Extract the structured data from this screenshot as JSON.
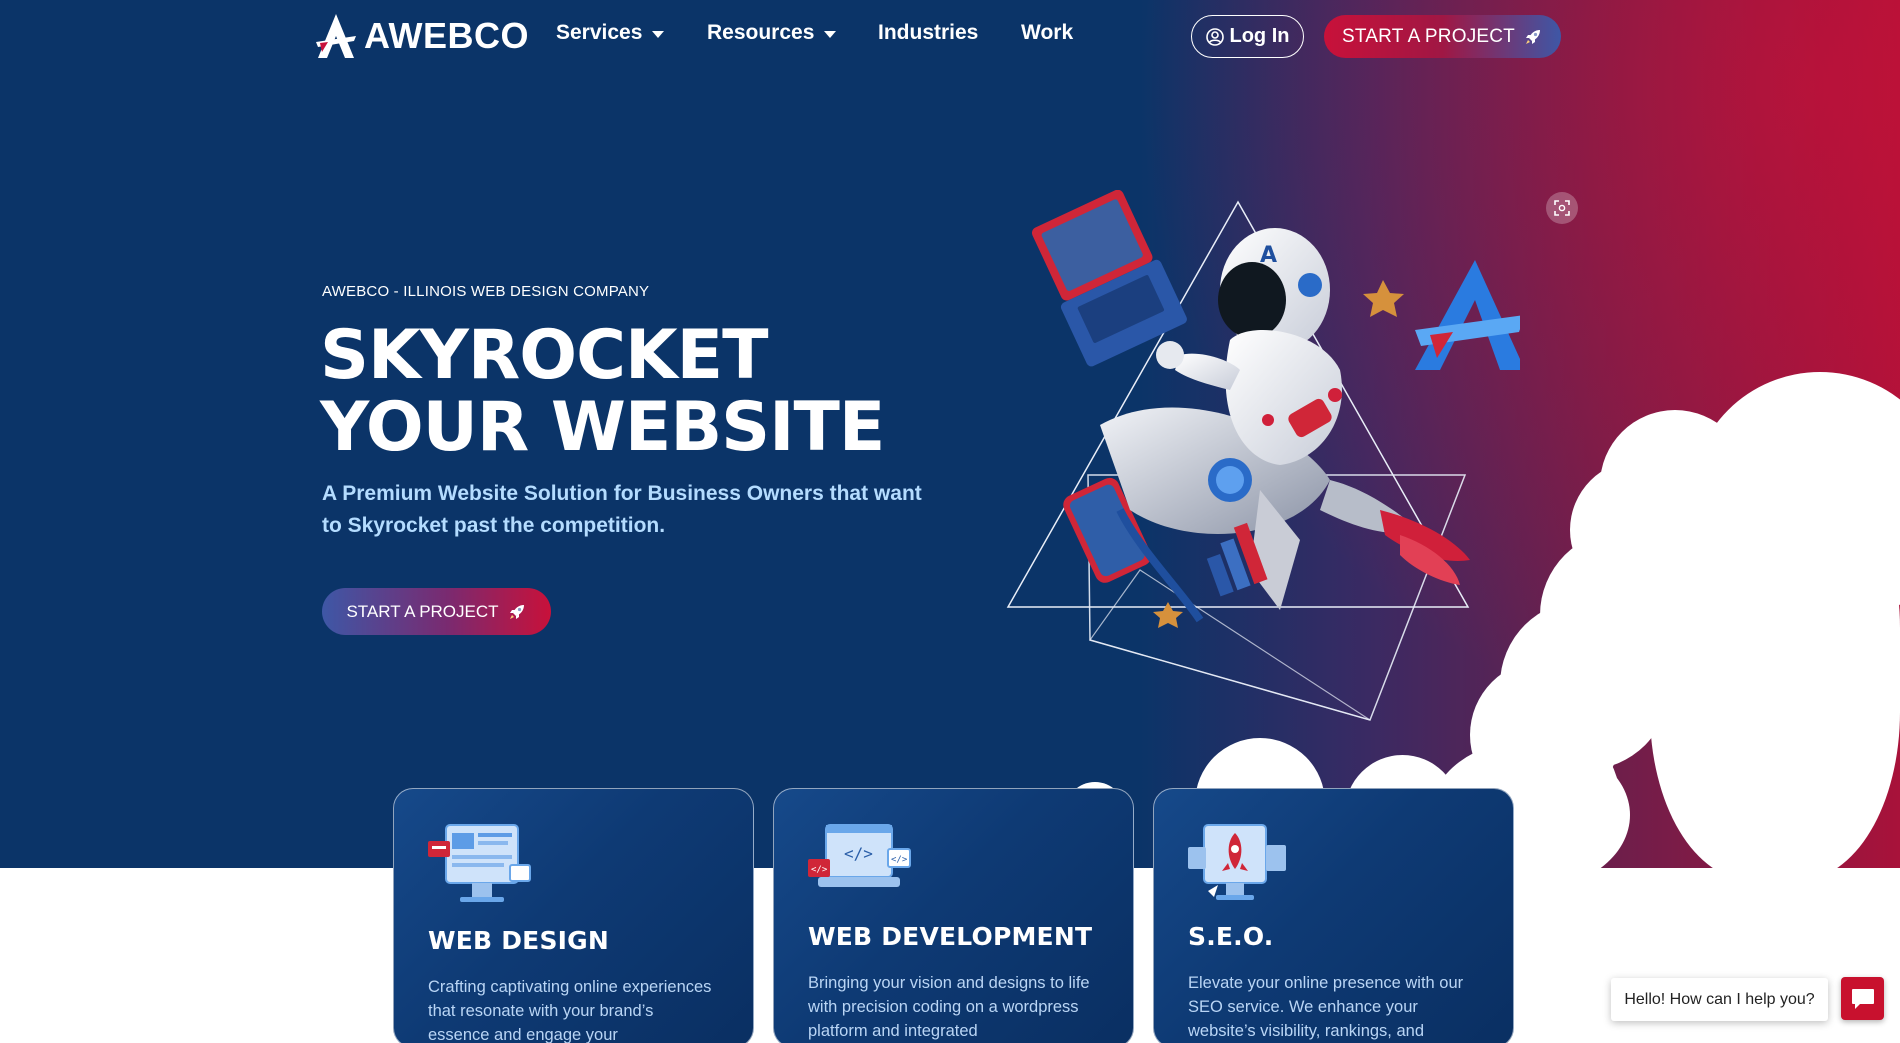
{
  "brand": {
    "name": "AWEBCO"
  },
  "nav": {
    "items": [
      {
        "label": "Services",
        "dropdown": true
      },
      {
        "label": "Resources",
        "dropdown": true
      },
      {
        "label": "Industries",
        "dropdown": false
      },
      {
        "label": "Work",
        "dropdown": false
      }
    ],
    "login_label": "Log In",
    "cta_label": "START A PROJECT"
  },
  "hero": {
    "eyebrow": "AWEBCO - ILLINOIS WEB DESIGN COMPANY",
    "headline_line1": "SKYROCKET",
    "headline_line2": "YOUR WEBSITE",
    "subline": "A Premium Website Solution for Business Owners that want to Skyrocket past the competition.",
    "cta_label": "START A PROJECT"
  },
  "cards": [
    {
      "title": "WEB DESIGN",
      "text": "Crafting captivating online experiences that resonate with your brand’s essence and engage your"
    },
    {
      "title": "WEB DEVELOPMENT",
      "text": "Bringing your vision and designs to life with precision coding on a wordpress platform and integrated"
    },
    {
      "title": "S.E.O.",
      "text": "Elevate your online presence with our SEO service. We enhance your website’s visibility, rankings, and"
    }
  ],
  "chat": {
    "greeting": "Hello! How can I help you?"
  },
  "colors": {
    "navy": "#0b3468",
    "crimson": "#c8113a",
    "light_blue_text": "#b4dcff",
    "card_text": "#b9d5f5"
  },
  "icons": [
    "awebco-logo-icon",
    "caret-down-icon",
    "user-icon",
    "rocket-icon",
    "screenshot-icon",
    "chat-icon"
  ]
}
